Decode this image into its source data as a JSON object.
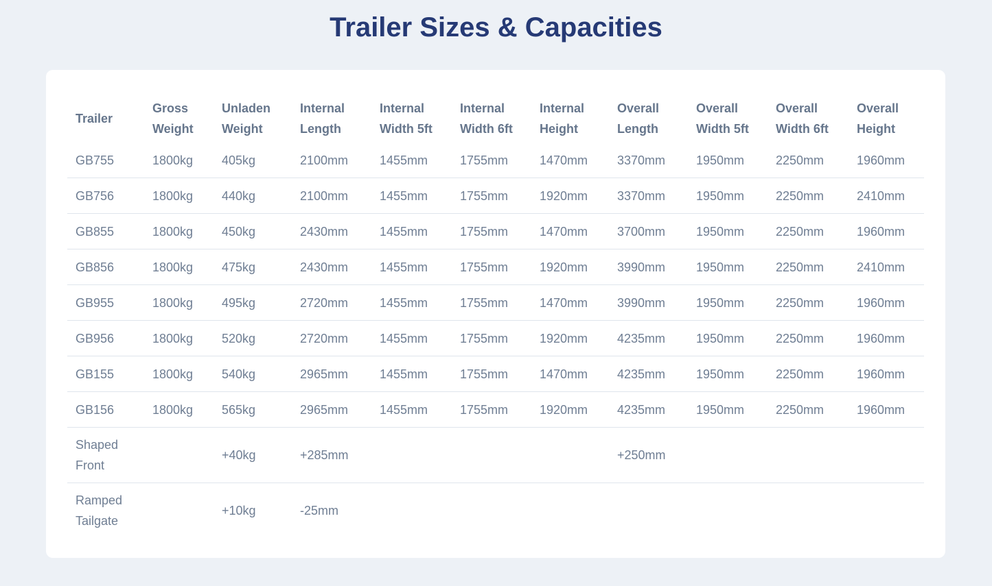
{
  "title": "Trailer Sizes & Capacities",
  "headers": [
    "Trailer",
    "Gross Weight",
    "Unladen Weight",
    "Internal Length",
    "Internal Width 5ft",
    "Internal Width 6ft",
    "Internal Height",
    "Overall Length",
    "Overall Width 5ft",
    "Overall Width 6ft",
    "Overall Height"
  ],
  "rows": [
    [
      "GB755",
      "1800kg",
      "405kg",
      "2100mm",
      "1455mm",
      "1755mm",
      "1470mm",
      "3370mm",
      "1950mm",
      "2250mm",
      "1960mm"
    ],
    [
      "GB756",
      "1800kg",
      "440kg",
      "2100mm",
      "1455mm",
      "1755mm",
      "1920mm",
      "3370mm",
      "1950mm",
      "2250mm",
      "2410mm"
    ],
    [
      "GB855",
      "1800kg",
      "450kg",
      "2430mm",
      "1455mm",
      "1755mm",
      "1470mm",
      "3700mm",
      "1950mm",
      "2250mm",
      "1960mm"
    ],
    [
      "GB856",
      "1800kg",
      "475kg",
      "2430mm",
      "1455mm",
      "1755mm",
      "1920mm",
      "3990mm",
      "1950mm",
      "2250mm",
      "2410mm"
    ],
    [
      "GB955",
      "1800kg",
      "495kg",
      "2720mm",
      "1455mm",
      "1755mm",
      "1470mm",
      "3990mm",
      "1950mm",
      "2250mm",
      "1960mm"
    ],
    [
      "GB956",
      "1800kg",
      "520kg",
      "2720mm",
      "1455mm",
      "1755mm",
      "1920mm",
      "4235mm",
      "1950mm",
      "2250mm",
      "1960mm"
    ],
    [
      "GB155",
      "1800kg",
      "540kg",
      "2965mm",
      "1455mm",
      "1755mm",
      "1470mm",
      "4235mm",
      "1950mm",
      "2250mm",
      "1960mm"
    ],
    [
      "GB156",
      "1800kg",
      "565kg",
      "2965mm",
      "1455mm",
      "1755mm",
      "1920mm",
      "4235mm",
      "1950mm",
      "2250mm",
      "1960mm"
    ],
    [
      "Shaped Front",
      "",
      "+40kg",
      "+285mm",
      "",
      "",
      "",
      "+250mm",
      "",
      "",
      ""
    ],
    [
      "Ramped Tailgate",
      "",
      "+10kg",
      "-25mm",
      "",
      "",
      "",
      "",
      "",
      "",
      ""
    ]
  ]
}
